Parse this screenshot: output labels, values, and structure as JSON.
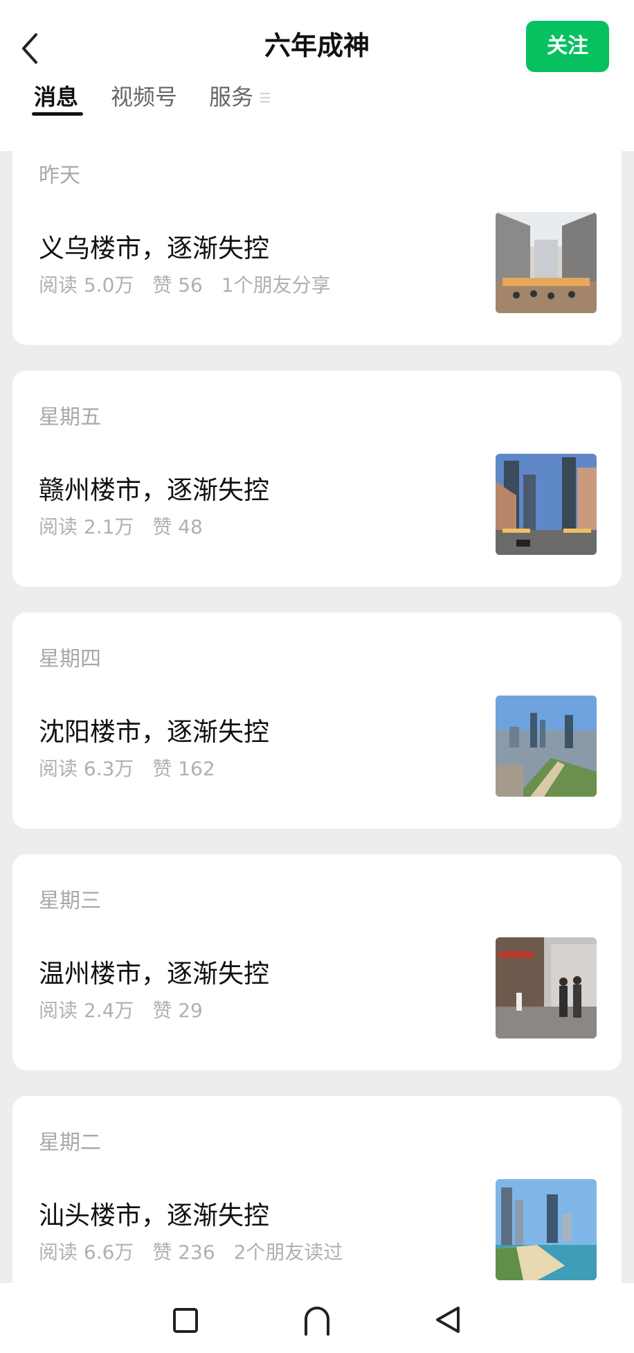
{
  "header": {
    "title": "六年成神",
    "follow_label": "关注"
  },
  "tabs": [
    {
      "label": "消息",
      "active": true
    },
    {
      "label": "视频号",
      "active": false
    },
    {
      "label": "服务",
      "active": false
    }
  ],
  "icons": {
    "back": "chevron-left-icon",
    "menu": "menu-lines-icon",
    "nav_home": "square-icon",
    "nav_recent": "arch-icon",
    "nav_back": "triangle-back-icon"
  },
  "accent_color": "#07c160",
  "articles": [
    {
      "date": "昨天",
      "title": "义乌楼市，逐渐失控",
      "reads": "阅读 5.0万",
      "likes": "赞 56",
      "social": "1个朋友分享",
      "thumb": "market-street-image"
    },
    {
      "date": "星期五",
      "title": "赣州楼市，逐渐失控",
      "reads": "阅读 2.1万",
      "likes": "赞 48",
      "social": "",
      "thumb": "city-street-image"
    },
    {
      "date": "星期四",
      "title": "沈阳楼市，逐渐失控",
      "reads": "阅读 6.3万",
      "likes": "赞 162",
      "social": "",
      "thumb": "city-aerial-image"
    },
    {
      "date": "星期三",
      "title": "温州楼市，逐渐失控",
      "reads": "阅读 2.4万",
      "likes": "赞 29",
      "social": "",
      "thumb": "pedestrian-street-image"
    },
    {
      "date": "星期二",
      "title": "汕头楼市，逐渐失控",
      "reads": "阅读 6.6万",
      "likes": "赞 236",
      "social": "2个朋友读过",
      "thumb": "coastal-city-image"
    }
  ]
}
